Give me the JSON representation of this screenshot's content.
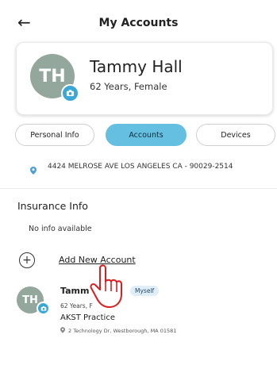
{
  "header": {
    "title": "My Accounts",
    "back_icon": "arrow-left-icon"
  },
  "profile": {
    "initials": "TH",
    "name": "Tammy Hall",
    "subtitle": "62 Years, Female"
  },
  "tabs": [
    {
      "label": "Personal Info",
      "active": false
    },
    {
      "label": "Accounts",
      "active": true
    },
    {
      "label": "Devices",
      "active": false
    }
  ],
  "address": "4424 MELROSE AVE LOS ANGELES CA - 90029-2514",
  "insurance": {
    "title": "Insurance Info",
    "empty_text": "No info available"
  },
  "add_account": {
    "label": "Add New Account"
  },
  "account": {
    "initials": "TH",
    "name": "Tamm",
    "badge": "Myself",
    "subtitle": "62 Years, F",
    "practice": "AKST Practice",
    "address": "2 Technology Dr, Westborough, MA 01581"
  },
  "colors": {
    "accent": "#65bfe0",
    "avatar": "#93a79c",
    "camera": "#3aa7d6"
  }
}
